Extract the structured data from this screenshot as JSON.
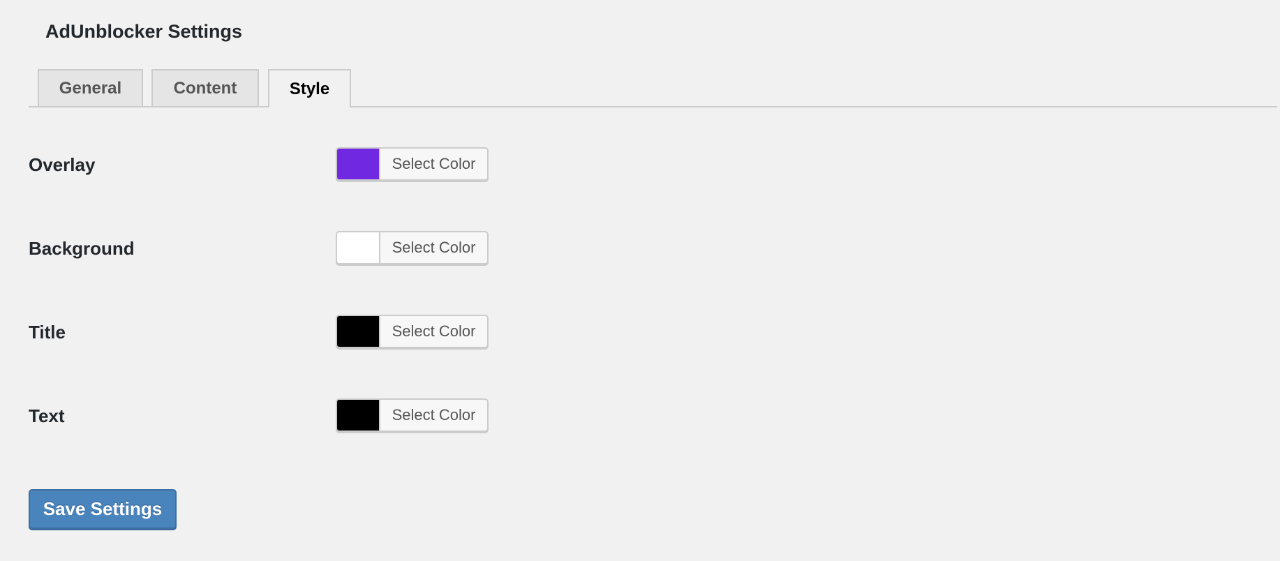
{
  "page": {
    "title": "AdUnblocker Settings"
  },
  "tabs": [
    {
      "label": "General",
      "active": false
    },
    {
      "label": "Content",
      "active": false
    },
    {
      "label": "Style",
      "active": true
    }
  ],
  "fields": [
    {
      "label": "Overlay",
      "button_label": "Select Color",
      "color": "#7029e0"
    },
    {
      "label": "Background",
      "button_label": "Select Color",
      "color": "#ffffff"
    },
    {
      "label": "Title",
      "button_label": "Select Color",
      "color": "#000000"
    },
    {
      "label": "Text",
      "button_label": "Select Color",
      "color": "#000000"
    }
  ],
  "actions": {
    "save_label": "Save Settings"
  }
}
